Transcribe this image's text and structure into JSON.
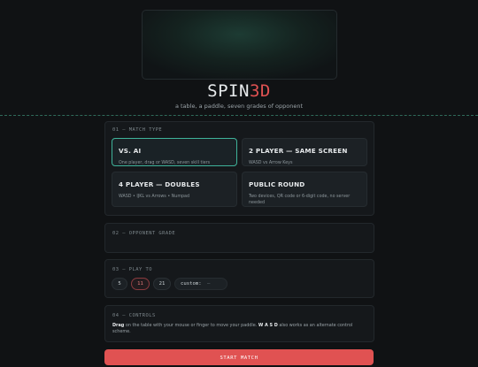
{
  "app": {
    "title_main": "SPIN",
    "title_accent": "3D",
    "tagline": "a table, a paddle, seven grades of opponent"
  },
  "match_type": {
    "label": "01 — MATCH TYPE",
    "selected": "vs-ai",
    "options": [
      {
        "title": "VS. AI",
        "desc": "One player, drag or WASD, seven skill tiers"
      },
      {
        "title": "2 PLAYER — SAME SCREEN",
        "desc": "WASD vs Arrow Keys"
      },
      {
        "title": "4 PLAYER — DOUBLES",
        "desc": "WASD • IJKL vs Arrows • Numpad"
      },
      {
        "title": "PUBLIC ROUND",
        "desc": "Two devices, QR code or 6-digit code, no server needed"
      }
    ]
  },
  "opponent_grade": {
    "label": "02 — OPPONENT GRADE"
  },
  "play_to": {
    "label": "03 — PLAY TO",
    "options": [
      "5",
      "11",
      "21"
    ],
    "selected": "11",
    "custom_label": "custom:",
    "custom_value": "–"
  },
  "controls": {
    "label": "04 — CONTROLS",
    "drag_word": "Drag",
    "text_1": " on the table with your mouse or finger to move your paddle. ",
    "keys": "W A S D",
    "text_2": " also works as an alternate control scheme."
  },
  "start_button": {
    "label": "START MATCH"
  },
  "colors": {
    "accent_red": "#e05252",
    "accent_teal": "#3fb39a",
    "background": "#101214"
  }
}
